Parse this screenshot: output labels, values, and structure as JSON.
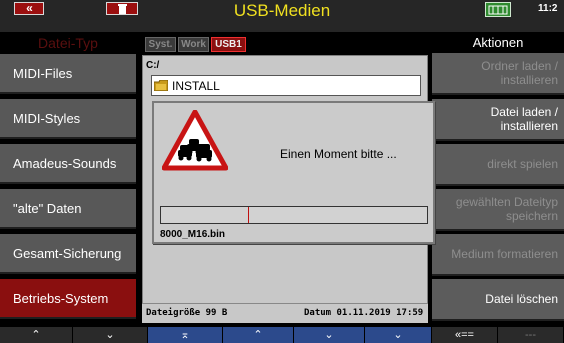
{
  "header": {
    "title": "USB-Medien",
    "time": "11:2",
    "back_label": "«"
  },
  "left_header": "Datei-Typ",
  "right_header": "Aktionen",
  "left_items": [
    {
      "label": "MIDI-Files"
    },
    {
      "label": "MIDI-Styles"
    },
    {
      "label": "Amadeus-Sounds"
    },
    {
      "label": "\"alte\" Daten"
    },
    {
      "label": "Gesamt-Sicherung"
    },
    {
      "label": "Betriebs-System",
      "active": true
    }
  ],
  "right_items": [
    {
      "line1": "Ordner laden /",
      "line2": "installieren",
      "enabled": false
    },
    {
      "line1": "Datei laden /",
      "line2": "installieren",
      "enabled": true
    },
    {
      "line1": "direkt spielen",
      "line2": "",
      "enabled": false
    },
    {
      "line1": "gewählten Dateityp",
      "line2": "speichern",
      "enabled": false
    },
    {
      "line1": "Medium formatieren",
      "line2": "",
      "enabled": false
    },
    {
      "line1": "Datei löschen",
      "line2": "",
      "enabled": true
    }
  ],
  "tabs": [
    {
      "label": "Syst."
    },
    {
      "label": "Work"
    },
    {
      "label": "USB1",
      "selected": true
    }
  ],
  "browser": {
    "path": "C:/",
    "items": [
      {
        "name": "INSTALL",
        "type": "folder"
      }
    ],
    "status_size": "Dateigröße 99 B",
    "status_date": "Datum 01.11.2019  17:59"
  },
  "dialog": {
    "message": "Einen Moment bitte ...",
    "file": "8000_M16.bin",
    "progress": 0.33
  },
  "bottom_bar": [
    {
      "label": "⌃"
    },
    {
      "label": "⌄"
    },
    {
      "label": "⌅"
    },
    {
      "label": "⌃"
    },
    {
      "label": "⌄"
    },
    {
      "label": "⌄"
    },
    {
      "label": "«=="
    },
    {
      "label": "---"
    }
  ],
  "colors": {
    "accent_red": "#8a0f0f",
    "title_yellow": "#f0e020",
    "nav_blue": "#2c4a8c"
  }
}
